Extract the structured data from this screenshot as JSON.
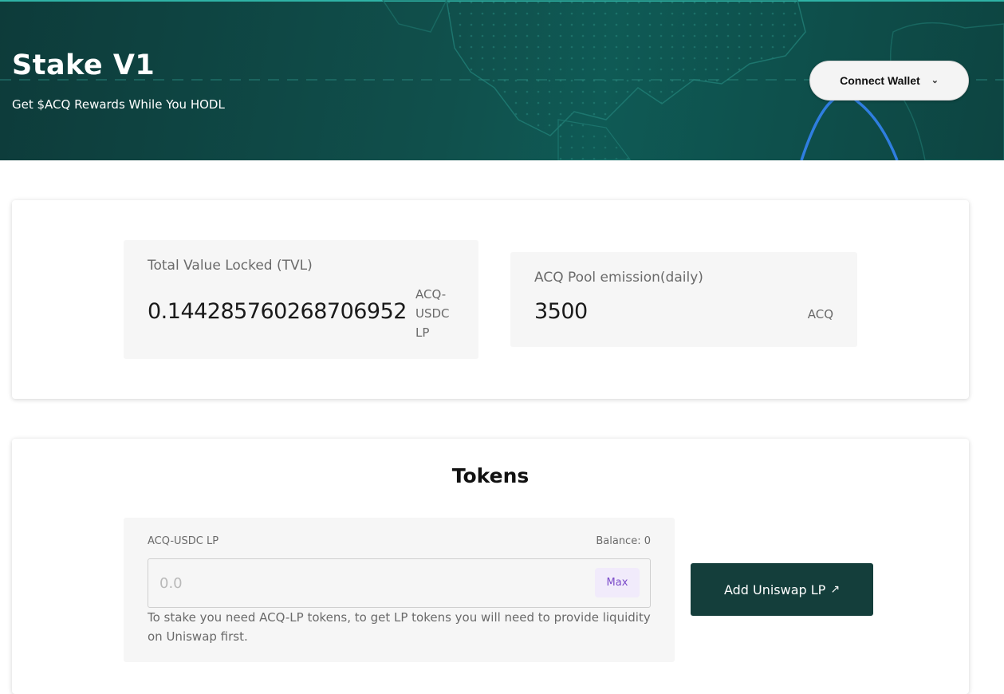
{
  "header": {
    "title": "Stake V1",
    "subtitle": "Get $ACQ Rewards While You HODL",
    "connect_wallet_label": "Connect Wallet",
    "chevron_glyph": "⌄"
  },
  "stats": {
    "tvl": {
      "label": "Total Value Locked (TVL)",
      "value": "0.144285760268706952",
      "unit": "ACQ-USDC LP"
    },
    "emission": {
      "label": "ACQ Pool emission(daily)",
      "value": "3500",
      "unit": "ACQ"
    }
  },
  "tokens": {
    "title": "Tokens",
    "token_name": "ACQ-USDC LP",
    "balance": "Balance: 0",
    "amount_placeholder": "0.0",
    "max_label": "Max",
    "helper_text": "To stake you need ACQ-LP tokens, to get LP tokens you will need to provide liquidity on Uniswap first.",
    "add_lp_label": "Add Uniswap LP",
    "external_glyph": "↗"
  },
  "colors": {
    "banner": "#0f4f4b",
    "button_dark": "#143e3b",
    "max_bg": "#f1ebfb",
    "max_text": "#7b4bc9",
    "panel_bg": "#f6f6f6"
  },
  "icons": {
    "connect_wallet": "chevron-down-icon",
    "add_lp": "external-link-icon"
  }
}
